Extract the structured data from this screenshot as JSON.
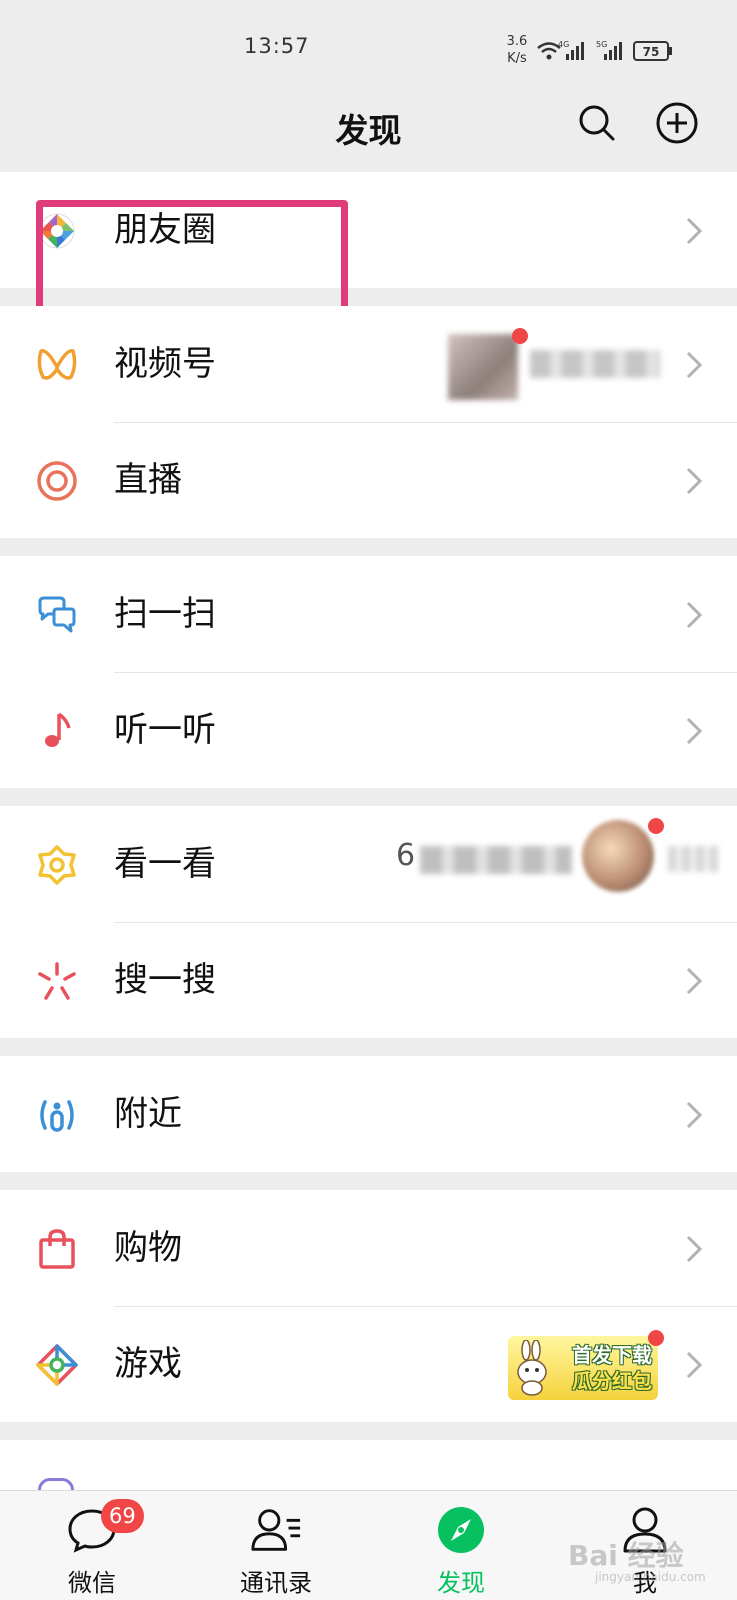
{
  "status_bar": {
    "time": "13:57",
    "net_speed_value": "3.6",
    "net_speed_unit": "K/s",
    "network_4g": "4G",
    "network_5g": "5G",
    "battery": "75"
  },
  "header": {
    "title": "发现",
    "search_icon": "search-icon",
    "add_icon": "add-circle-icon"
  },
  "sections": [
    {
      "rows": [
        {
          "label": "朋友圈",
          "icon": "moments-icon"
        }
      ]
    },
    {
      "rows": [
        {
          "label": "视频号",
          "icon": "channels-icon"
        },
        {
          "label": "直播",
          "icon": "live-icon"
        }
      ]
    },
    {
      "rows": [
        {
          "label": "扫一扫",
          "icon": "scan-icon"
        },
        {
          "label": "听一听",
          "icon": "music-note-icon"
        }
      ]
    },
    {
      "rows": [
        {
          "label": "看一看",
          "icon": "top-stories-icon"
        },
        {
          "label": "搜一搜",
          "icon": "search-sparkle-icon"
        }
      ]
    },
    {
      "rows": [
        {
          "label": "附近",
          "icon": "nearby-icon"
        }
      ]
    },
    {
      "rows": [
        {
          "label": "购物",
          "icon": "shopping-bag-icon"
        },
        {
          "label": "游戏",
          "icon": "games-icon"
        }
      ]
    }
  ],
  "kan_preview_text": "6",
  "game_promo": {
    "line1": "首发下载",
    "line2": "瓜分红包"
  },
  "tabs": [
    {
      "label": "微信",
      "icon": "chat-bubble-icon",
      "badge": "69"
    },
    {
      "label": "通讯录",
      "icon": "contacts-icon"
    },
    {
      "label": "发现",
      "icon": "compass-icon",
      "active": true
    },
    {
      "label": "我",
      "icon": "me-icon"
    }
  ],
  "watermark": {
    "text": "Bai 经验",
    "sub": "jingyan.baidu.com"
  },
  "colors": {
    "accent": "#07c160",
    "badge": "#f04646",
    "highlight": "#e03c7c"
  }
}
